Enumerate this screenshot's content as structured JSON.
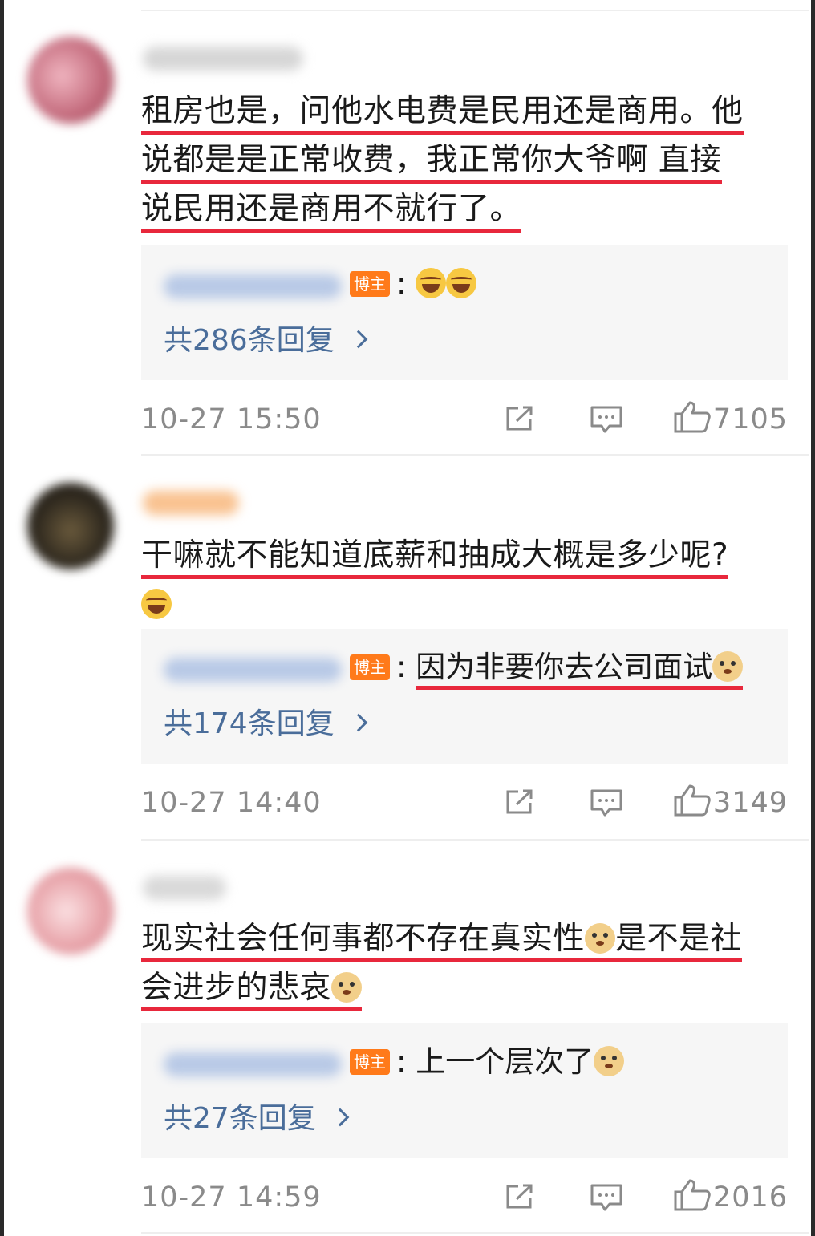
{
  "comments": [
    {
      "text_lines": [
        "租房也是，问他水电费是民用还是商用。他",
        "说都是是正常收费，我正常你大爷啊 直接",
        "说民用还是商用不就行了。"
      ],
      "author_badge": "博主",
      "reply_text": ":",
      "reply_emojis": [
        "laugh-cry-emoji",
        "laugh-cry-emoji"
      ],
      "reply_count": "共286条回复",
      "time": "10-27 15:50",
      "likes": "7105",
      "avatar_color": "#c2687a"
    },
    {
      "text_lines": [
        "干嘛就不能知道底薪和抽成大概是多少呢?"
      ],
      "text_trailing_emoji": "laugh-cry-emoji",
      "author_badge": "博主",
      "reply_text": "因为非要你去公司面试",
      "reply_emojis": [
        "doge-emoji"
      ],
      "reply_count": "共174条回复",
      "time": "10-27 14:40",
      "likes": "3149",
      "avatar_color": "#3a3226"
    },
    {
      "text_lines": [
        "现实社会任何事都不存在真实性",
        "是不是社",
        "会进步的悲哀"
      ],
      "author_badge": "博主",
      "reply_text": "上一个层次了",
      "reply_emojis": [
        "doge-emoji"
      ],
      "reply_count": "共27条回复",
      "time": "10-27 14:59",
      "likes": "2016",
      "avatar_color": "#e8a4aa"
    }
  ],
  "icons": {
    "share": "share-icon",
    "comment": "comment-icon",
    "like": "thumbs-up-icon"
  },
  "colors": {
    "underline": "#e8283c",
    "badge": "#ff7a1a",
    "reply_link": "#4a6d9a",
    "meta_text": "#8a8a8a",
    "reply_bg": "#f6f6f6"
  }
}
